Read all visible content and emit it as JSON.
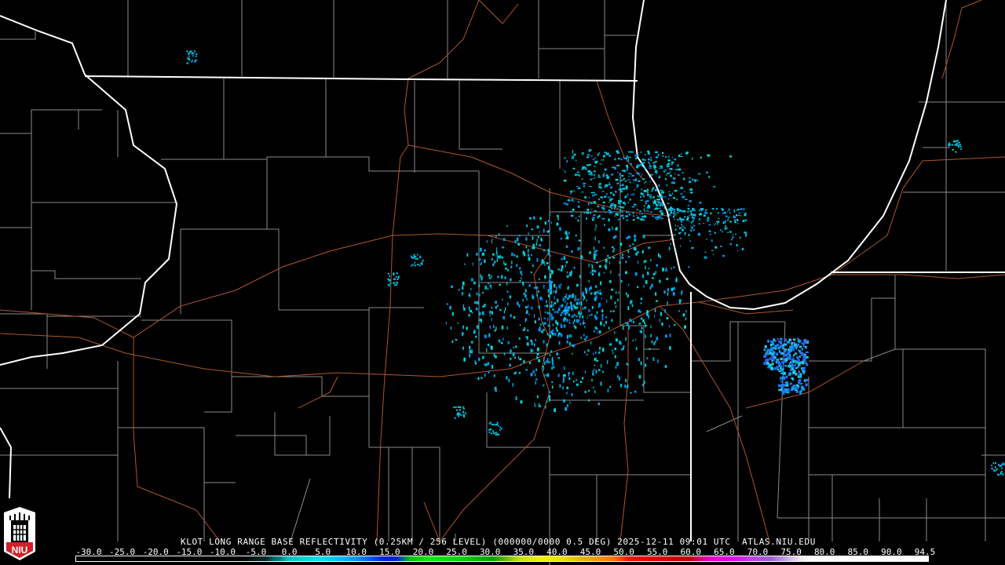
{
  "product": {
    "title": "KLOT LONG RANGE BASE REFLECTIVITY (0.25KM / 256 LEVEL) (000000/0000 0.5 DEG) 2025-12-11 09:01 UTC  ATLAS.NIU.EDU"
  },
  "logo": {
    "text": "NIU"
  },
  "legend": {
    "labels": [
      "-30.0",
      "-25.0",
      "-20.0",
      "-15.0",
      "-10.0",
      "-5.0",
      "0.0",
      "5.0",
      "10.0",
      "15.0",
      "20.0",
      "25.0",
      "30.0",
      "35.0",
      "40.0",
      "45.0",
      "50.0",
      "55.0",
      "60.0",
      "65.0",
      "70.0",
      "75.0",
      "80.0",
      "85.0",
      "90.0",
      "94.5"
    ],
    "range": [
      -30,
      95
    ],
    "color_stops": [
      [
        -30,
        "#000000"
      ],
      [
        -6,
        "#000000"
      ],
      [
        -4,
        "#001818"
      ],
      [
        -2,
        "#002a2a"
      ],
      [
        -1,
        "#006a6a"
      ],
      [
        0,
        "#008080"
      ],
      [
        1,
        "#00c0c0"
      ],
      [
        4,
        "#00d8d8"
      ],
      [
        6,
        "#00e0f0"
      ],
      [
        9,
        "#00b8f0"
      ],
      [
        11,
        "#0098f0"
      ],
      [
        13,
        "#0060f0"
      ],
      [
        15,
        "#0020e0"
      ],
      [
        17,
        "#0020d0"
      ],
      [
        18,
        "#007080"
      ],
      [
        19,
        "#00c000"
      ],
      [
        22,
        "#00f000"
      ],
      [
        27,
        "#00d000"
      ],
      [
        31,
        "#00a000"
      ],
      [
        33,
        "#60b800"
      ],
      [
        35,
        "#c0e000"
      ],
      [
        38,
        "#f0f000"
      ],
      [
        41,
        "#f0e000"
      ],
      [
        44,
        "#e0b800"
      ],
      [
        47,
        "#f09000"
      ],
      [
        49,
        "#ff7000"
      ],
      [
        51,
        "#ff1000"
      ],
      [
        55,
        "#e00000"
      ],
      [
        60,
        "#c00000"
      ],
      [
        61,
        "#d00050"
      ],
      [
        63,
        "#f000c0"
      ],
      [
        66,
        "#e000f0"
      ],
      [
        69,
        "#c040e0"
      ],
      [
        72,
        "#a060d0"
      ],
      [
        74,
        "#c0a0e0"
      ],
      [
        76,
        "#f0e0f0"
      ],
      [
        78,
        "#ffffff"
      ],
      [
        95,
        "#ffffff"
      ]
    ]
  },
  "colors": {
    "state_border": "#ffffff",
    "county_line": "#8a8a8a",
    "highway": "#b0562a",
    "logo_red": "#d0202a"
  }
}
